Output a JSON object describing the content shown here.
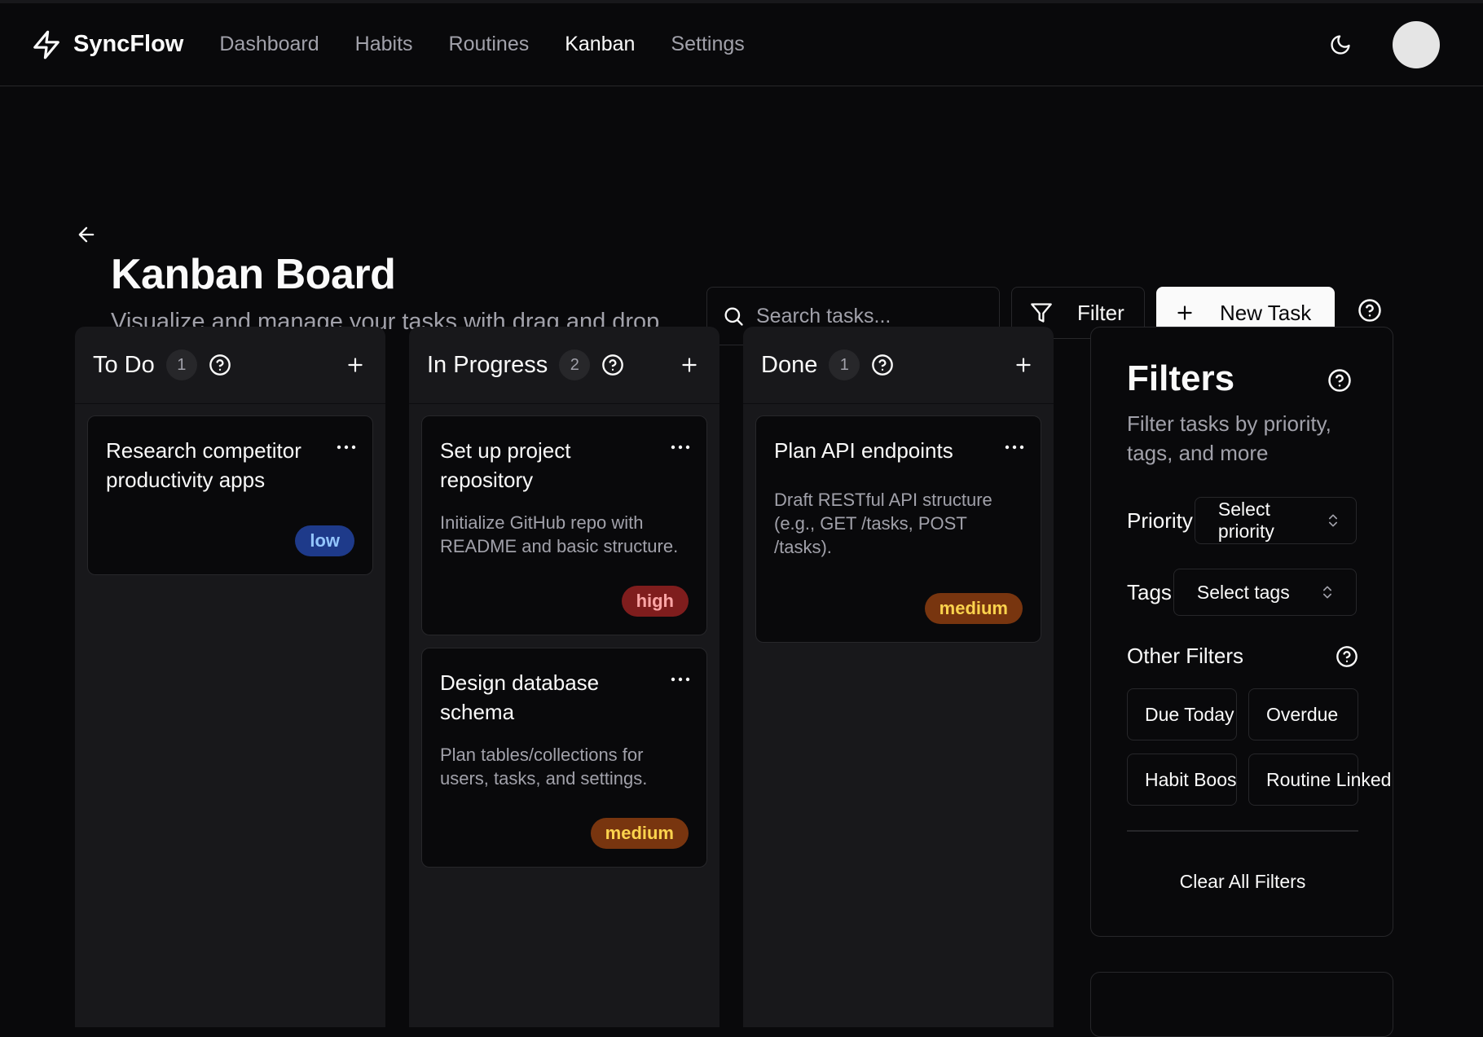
{
  "app": {
    "name": "SyncFlow"
  },
  "nav": {
    "items": [
      {
        "label": "Dashboard",
        "active": false
      },
      {
        "label": "Habits",
        "active": false
      },
      {
        "label": "Routines",
        "active": false
      },
      {
        "label": "Kanban",
        "active": true
      },
      {
        "label": "Settings",
        "active": false
      }
    ]
  },
  "header": {
    "theme_icon": "moon-icon"
  },
  "page": {
    "title": "Kanban Board",
    "subtitle": "Visualize and manage your tasks with drag and drop"
  },
  "toolbar": {
    "search_placeholder": "Search tasks...",
    "filter_label": "Filter",
    "new_task_label": "New Task"
  },
  "columns": [
    {
      "title": "To Do",
      "count": "1",
      "cards": [
        {
          "title": "Research competitor productivity apps",
          "description": "",
          "priority": "low"
        }
      ]
    },
    {
      "title": "In Progress",
      "count": "2",
      "cards": [
        {
          "title": "Set up project repository",
          "description": "Initialize GitHub repo with README and basic structure.",
          "priority": "high"
        },
        {
          "title": "Design database schema",
          "description": "Plan tables/collections for users, tasks, and settings.",
          "priority": "medium"
        }
      ]
    },
    {
      "title": "Done",
      "count": "1",
      "cards": [
        {
          "title": "Plan API endpoints",
          "description": "Draft RESTful API structure (e.g., GET /tasks, POST /tasks).",
          "priority": "medium"
        }
      ]
    }
  ],
  "filters": {
    "title": "Filters",
    "subtitle": "Filter tasks by priority, tags, and more",
    "priority_label": "Priority",
    "priority_placeholder": "Select priority",
    "tags_label": "Tags",
    "tags_placeholder": "Select tags",
    "other_label": "Other Filters",
    "chips": [
      "Due Today",
      "Overdue",
      "Habit Booster",
      "Routine Linked"
    ],
    "clear_label": "Clear All Filters"
  },
  "colors": {
    "background": "#09090b",
    "low_bg": "#1e3a8a",
    "low_fg": "#93c5fd",
    "high_bg": "#7f1d1d",
    "high_fg": "#fca5a5",
    "medium_bg": "#78350f",
    "medium_fg": "#fcd34d"
  }
}
